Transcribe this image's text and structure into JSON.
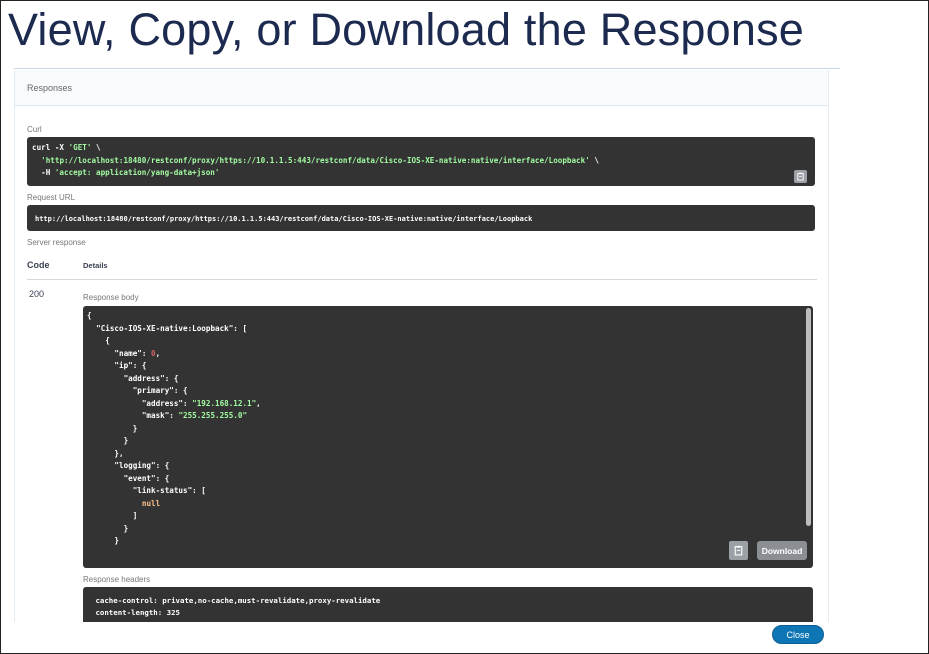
{
  "slide": {
    "title": "View, Copy, or Download the Response"
  },
  "responses": {
    "title": "Responses",
    "curl_label": "Curl",
    "curl_lines": [
      [
        {
          "t": "curl -X ",
          "c": ""
        },
        {
          "t": "'GET'",
          "c": "str"
        },
        {
          "t": " \\",
          "c": ""
        }
      ],
      [
        {
          "t": "  ",
          "c": ""
        },
        {
          "t": "'http://localhost:18480/restconf/proxy/https://10.1.1.5:443/restconf/data/Cisco-IOS-XE-native:native/interface/Loopback'",
          "c": "str"
        },
        {
          "t": " \\",
          "c": ""
        }
      ],
      [
        {
          "t": "  -H ",
          "c": ""
        },
        {
          "t": "'accept: application/yang-data+json'",
          "c": "str"
        }
      ]
    ],
    "request_url_label": "Request URL",
    "request_url": "http://localhost:18480/restconf/proxy/https://10.1.1.5:443/restconf/data/Cisco-IOS-XE-native:native/interface/Loopback",
    "server_response_label": "Server response",
    "col_code": "Code",
    "col_details": "Details",
    "status_code": "200",
    "response_body_label": "Response body",
    "body_lines": [
      [
        {
          "t": "{",
          "c": ""
        }
      ],
      [
        {
          "t": "  \"Cisco-IOS-XE-native:Loopback\": [",
          "c": ""
        }
      ],
      [
        {
          "t": "    {",
          "c": ""
        }
      ],
      [
        {
          "t": "      \"name\": ",
          "c": ""
        },
        {
          "t": "0",
          "c": "num"
        },
        {
          "t": ",",
          "c": ""
        }
      ],
      [
        {
          "t": "      \"ip\": {",
          "c": ""
        }
      ],
      [
        {
          "t": "        \"address\": {",
          "c": ""
        }
      ],
      [
        {
          "t": "          \"primary\": {",
          "c": ""
        }
      ],
      [
        {
          "t": "            \"address\": ",
          "c": ""
        },
        {
          "t": "\"192.168.12.1\"",
          "c": "str"
        },
        {
          "t": ",",
          "c": ""
        }
      ],
      [
        {
          "t": "            \"mask\": ",
          "c": ""
        },
        {
          "t": "\"255.255.255.0\"",
          "c": "str"
        }
      ],
      [
        {
          "t": "          }",
          "c": ""
        }
      ],
      [
        {
          "t": "        }",
          "c": ""
        }
      ],
      [
        {
          "t": "      },",
          "c": ""
        }
      ],
      [
        {
          "t": "      \"logging\": {",
          "c": ""
        }
      ],
      [
        {
          "t": "        \"event\": {",
          "c": ""
        }
      ],
      [
        {
          "t": "          \"link-status\": [",
          "c": ""
        }
      ],
      [
        {
          "t": "            ",
          "c": ""
        },
        {
          "t": "null",
          "c": "nul"
        }
      ],
      [
        {
          "t": "          ]",
          "c": ""
        }
      ],
      [
        {
          "t": "        }",
          "c": ""
        }
      ],
      [
        {
          "t": "      }",
          "c": ""
        }
      ]
    ],
    "download_label": "Download",
    "response_headers_label": "Response headers",
    "header_lines": [
      " cache-control: private,no-cache,must-revalidate,proxy-revalidate",
      " content-length: 325"
    ]
  },
  "footer": {
    "close_label": "Close"
  },
  "icons": {
    "copy": "clipboard-icon"
  }
}
